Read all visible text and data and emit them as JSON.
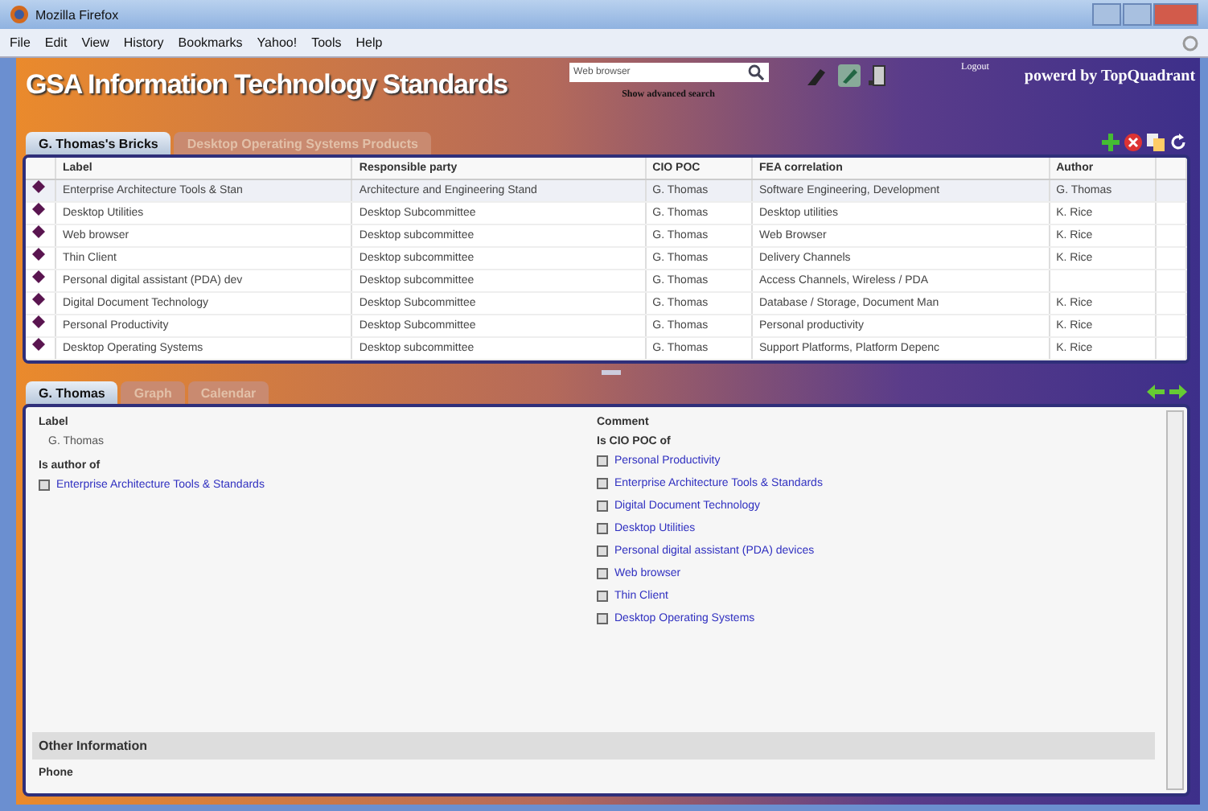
{
  "window": {
    "title": "Mozilla Firefox"
  },
  "menu": [
    "File",
    "Edit",
    "View",
    "History",
    "Bookmarks",
    "Yahoo!",
    "Tools",
    "Help"
  ],
  "header": {
    "title": "GSA Information Technology Standards",
    "search": {
      "value": "Web browser"
    },
    "advanced_link": "Show advanced search",
    "logout": "Logout",
    "powered_by": "powerd by TopQuadrant"
  },
  "top_tabs": [
    {
      "label": "G. Thomas's Bricks",
      "selected": true
    },
    {
      "label": "Desktop Operating Systems Products",
      "selected": false
    }
  ],
  "table": {
    "columns": [
      "Label",
      "Responsible party",
      "CIO POC",
      "FEA correlation",
      "Author"
    ],
    "rows": [
      [
        "Enterprise Architecture Tools & Stan",
        "Architecture and Engineering Stand",
        "G. Thomas",
        "Software Engineering, Development",
        "G. Thomas"
      ],
      [
        "Desktop Utilities",
        "Desktop Subcommittee",
        "G. Thomas",
        "Desktop utilities",
        "K. Rice"
      ],
      [
        "Web browser",
        "Desktop subcommittee",
        "G. Thomas",
        "Web Browser",
        "K. Rice"
      ],
      [
        "Thin Client",
        "Desktop subcommittee",
        "G. Thomas",
        "Delivery Channels",
        "K. Rice"
      ],
      [
        "Personal digital assistant (PDA) dev",
        "Desktop subcommittee",
        "G. Thomas",
        "Access Channels, Wireless / PDA",
        ""
      ],
      [
        "Digital Document Technology",
        "Desktop Subcommittee",
        "G. Thomas",
        "Database / Storage, Document Man",
        "K. Rice"
      ],
      [
        "Personal Productivity",
        "Desktop Subcommittee",
        "G. Thomas",
        "Personal productivity",
        "K. Rice"
      ],
      [
        "Desktop Operating Systems",
        "Desktop subcommittee",
        "G. Thomas",
        "Support Platforms, Platform Depenc",
        "K. Rice"
      ]
    ]
  },
  "bottom_tabs": [
    {
      "label": "G. Thomas",
      "selected": true
    },
    {
      "label": "Graph",
      "selected": false
    },
    {
      "label": "Calendar",
      "selected": false
    }
  ],
  "detail": {
    "label_heading": "Label",
    "label_value": "G. Thomas",
    "author_heading": "Is author of",
    "author_of": [
      "Enterprise Architecture Tools & Standards"
    ],
    "comment_heading": "Comment",
    "cio_heading": "Is CIO POC of",
    "cio_of": [
      "Personal Productivity",
      "Enterprise Architecture Tools & Standards",
      "Digital Document Technology",
      "Desktop Utilities",
      "Personal digital assistant (PDA) devices",
      "Web browser",
      "Thin Client",
      "Desktop Operating Systems"
    ],
    "other_heading": "Other Information",
    "phone_heading": "Phone"
  }
}
